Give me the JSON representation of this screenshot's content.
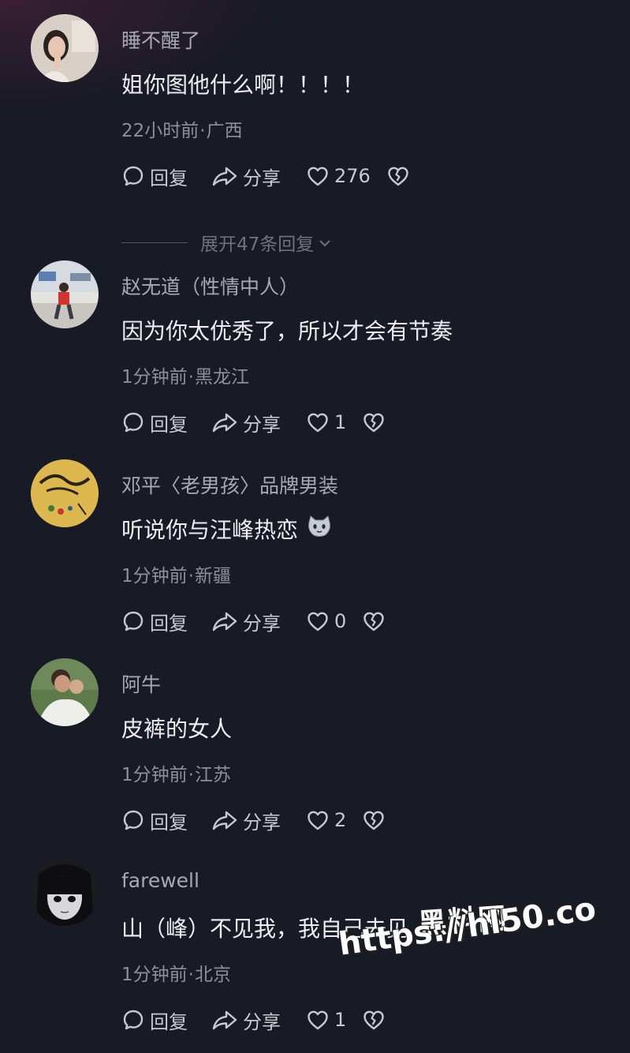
{
  "actions": {
    "reply_label": "回复",
    "share_label": "分享"
  },
  "expand_replies": "展开47条回复",
  "comments": [
    {
      "username": "睡不醒了",
      "text": "姐你图他什么啊！！！！",
      "time": "22小时前",
      "location": "广西",
      "likes": "276"
    },
    {
      "username": "赵无道（性情中人）",
      "text": "因为你太优秀了，所以才会有节奏",
      "time": "1分钟前",
      "location": "黑龙江",
      "likes": "1"
    },
    {
      "username": "邓平〈老男孩〉品牌男装",
      "text": "听说你与汪峰热恋",
      "time": "1分钟前",
      "location": "新疆",
      "likes": "0"
    },
    {
      "username": "阿牛",
      "text": "皮裤的女人",
      "time": "1分钟前",
      "location": "江苏",
      "likes": "2"
    },
    {
      "username": "farewell",
      "text": "山（峰）不见我，我自己去见",
      "time": "1分钟前",
      "location": "北京",
      "likes": "1"
    }
  ],
  "watermark": {
    "title": "黑料网",
    "url": "https://hl50.co"
  },
  "icons": {
    "reply": "comment-bubble-icon",
    "share": "share-arrow-icon",
    "like": "heart-icon",
    "dislike": "broken-heart-icon",
    "emoji": "cat-emoji-icon"
  },
  "colors": {
    "background": "#181a25",
    "username": "#a7a9b2",
    "text": "#eeeef1",
    "meta": "#8d8f99"
  }
}
